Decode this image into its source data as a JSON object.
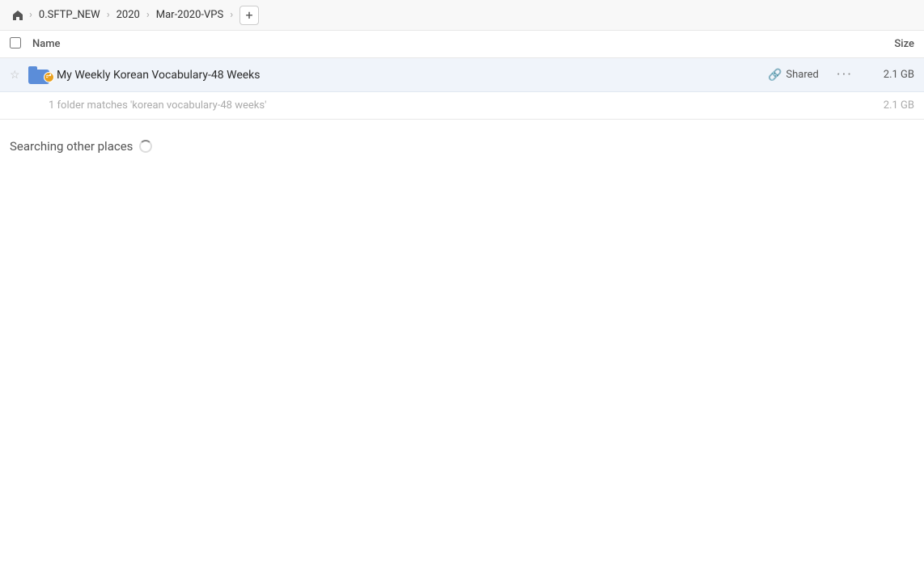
{
  "breadcrumb": {
    "home_icon": "🏠",
    "items": [
      "0.SFTP_NEW",
      "2020",
      "Mar-2020-VPS"
    ],
    "add_label": "+"
  },
  "columns": {
    "name_label": "Name",
    "size_label": "Size"
  },
  "file_row": {
    "name": "My Weekly Korean Vocabulary-48 Weeks",
    "shared_label": "Shared",
    "more_label": "···",
    "size": "2.1 GB"
  },
  "match_info": {
    "text": "1 folder matches 'korean vocabulary-48 weeks'",
    "size": "2.1 GB"
  },
  "searching": {
    "title": "Searching other places"
  }
}
